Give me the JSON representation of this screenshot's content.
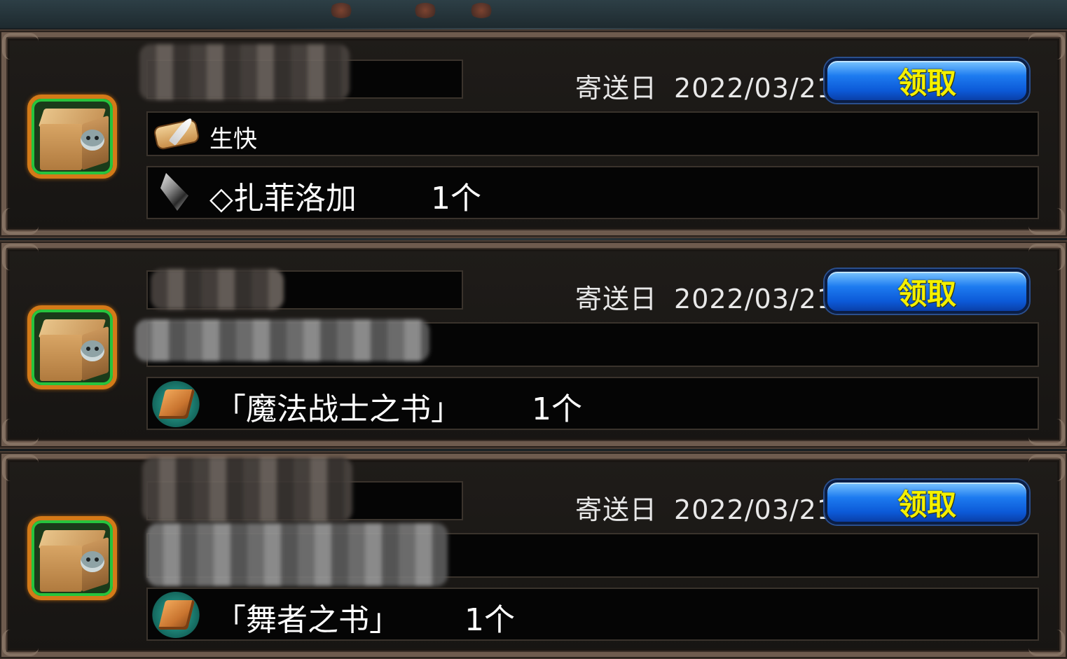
{
  "mails": [
    {
      "date_prefix": "寄送日",
      "date": "2022/03/21",
      "claim_label": "领取",
      "subject": "生快",
      "subject_icon": "scroll-quill-icon",
      "item_name": "◇扎菲洛加",
      "item_icon": "crystal-shard-icon",
      "item_qty": "1个",
      "package_icon": "package-box-icon"
    },
    {
      "date_prefix": "寄送日",
      "date": "2022/03/21",
      "claim_label": "领取",
      "subject": "",
      "item_name": "「魔法战士之书」",
      "item_icon": "book-icon",
      "item_qty": "1个",
      "package_icon": "package-box-icon"
    },
    {
      "date_prefix": "寄送日",
      "date": "2022/03/21",
      "claim_label": "领取",
      "subject": "",
      "item_name": "「舞者之书」",
      "item_icon": "book-icon",
      "item_qty": "1个",
      "package_icon": "package-box-icon"
    }
  ],
  "colors": {
    "button_text": "#f4f000",
    "button_blue": "#0c5ad8",
    "package_border_green": "#27c43d",
    "package_border_orange": "#d47a18",
    "frame": "#6e5b4e"
  }
}
